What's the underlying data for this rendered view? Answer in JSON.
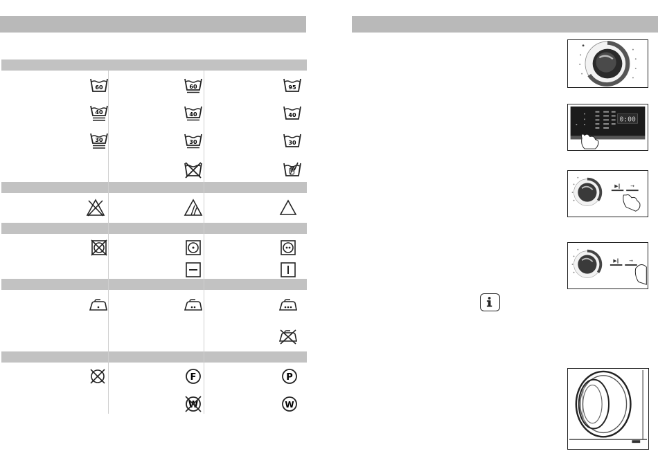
{
  "left_page": {
    "sections": [
      {
        "id": "washing",
        "rows": [
          [
            "wash-60",
            "wash-60-gentle",
            "wash-95"
          ],
          [
            "wash-40",
            "wash-40-gentle",
            "wash-40-normal"
          ],
          [
            "wash-30",
            "wash-30-gentle",
            "wash-30-normal"
          ],
          [
            null,
            "no-wash",
            "hand-wash"
          ]
        ]
      },
      {
        "id": "bleaching",
        "rows": [
          [
            "no-bleach",
            "chlorine-bleach",
            "bleach"
          ]
        ]
      },
      {
        "id": "drying",
        "rows": [
          [
            "no-tumble-dry",
            "tumble-dry-low",
            "tumble-dry-normal"
          ],
          [
            null,
            "dry-flat",
            "line-dry"
          ]
        ]
      },
      {
        "id": "ironing",
        "rows": [
          [
            "iron-low",
            "iron-medium",
            "iron-high"
          ],
          [
            null,
            null,
            "no-iron"
          ]
        ]
      },
      {
        "id": "dry-cleaning",
        "rows": [
          [
            "no-dry-clean",
            "dry-clean-f",
            "dry-clean-p"
          ],
          [
            null,
            "no-wet-clean",
            "wet-clean"
          ]
        ]
      }
    ],
    "wash_numbers": {
      "r0": [
        "60",
        "60",
        "95"
      ],
      "r1": [
        "40",
        "40",
        "40"
      ],
      "r2": [
        "30",
        "30",
        "30"
      ]
    },
    "clean_letters": {
      "f": "F",
      "p": "P",
      "w": "W"
    }
  },
  "right_page": {
    "panel_display": "0:00",
    "info_icon": "info-icon"
  }
}
